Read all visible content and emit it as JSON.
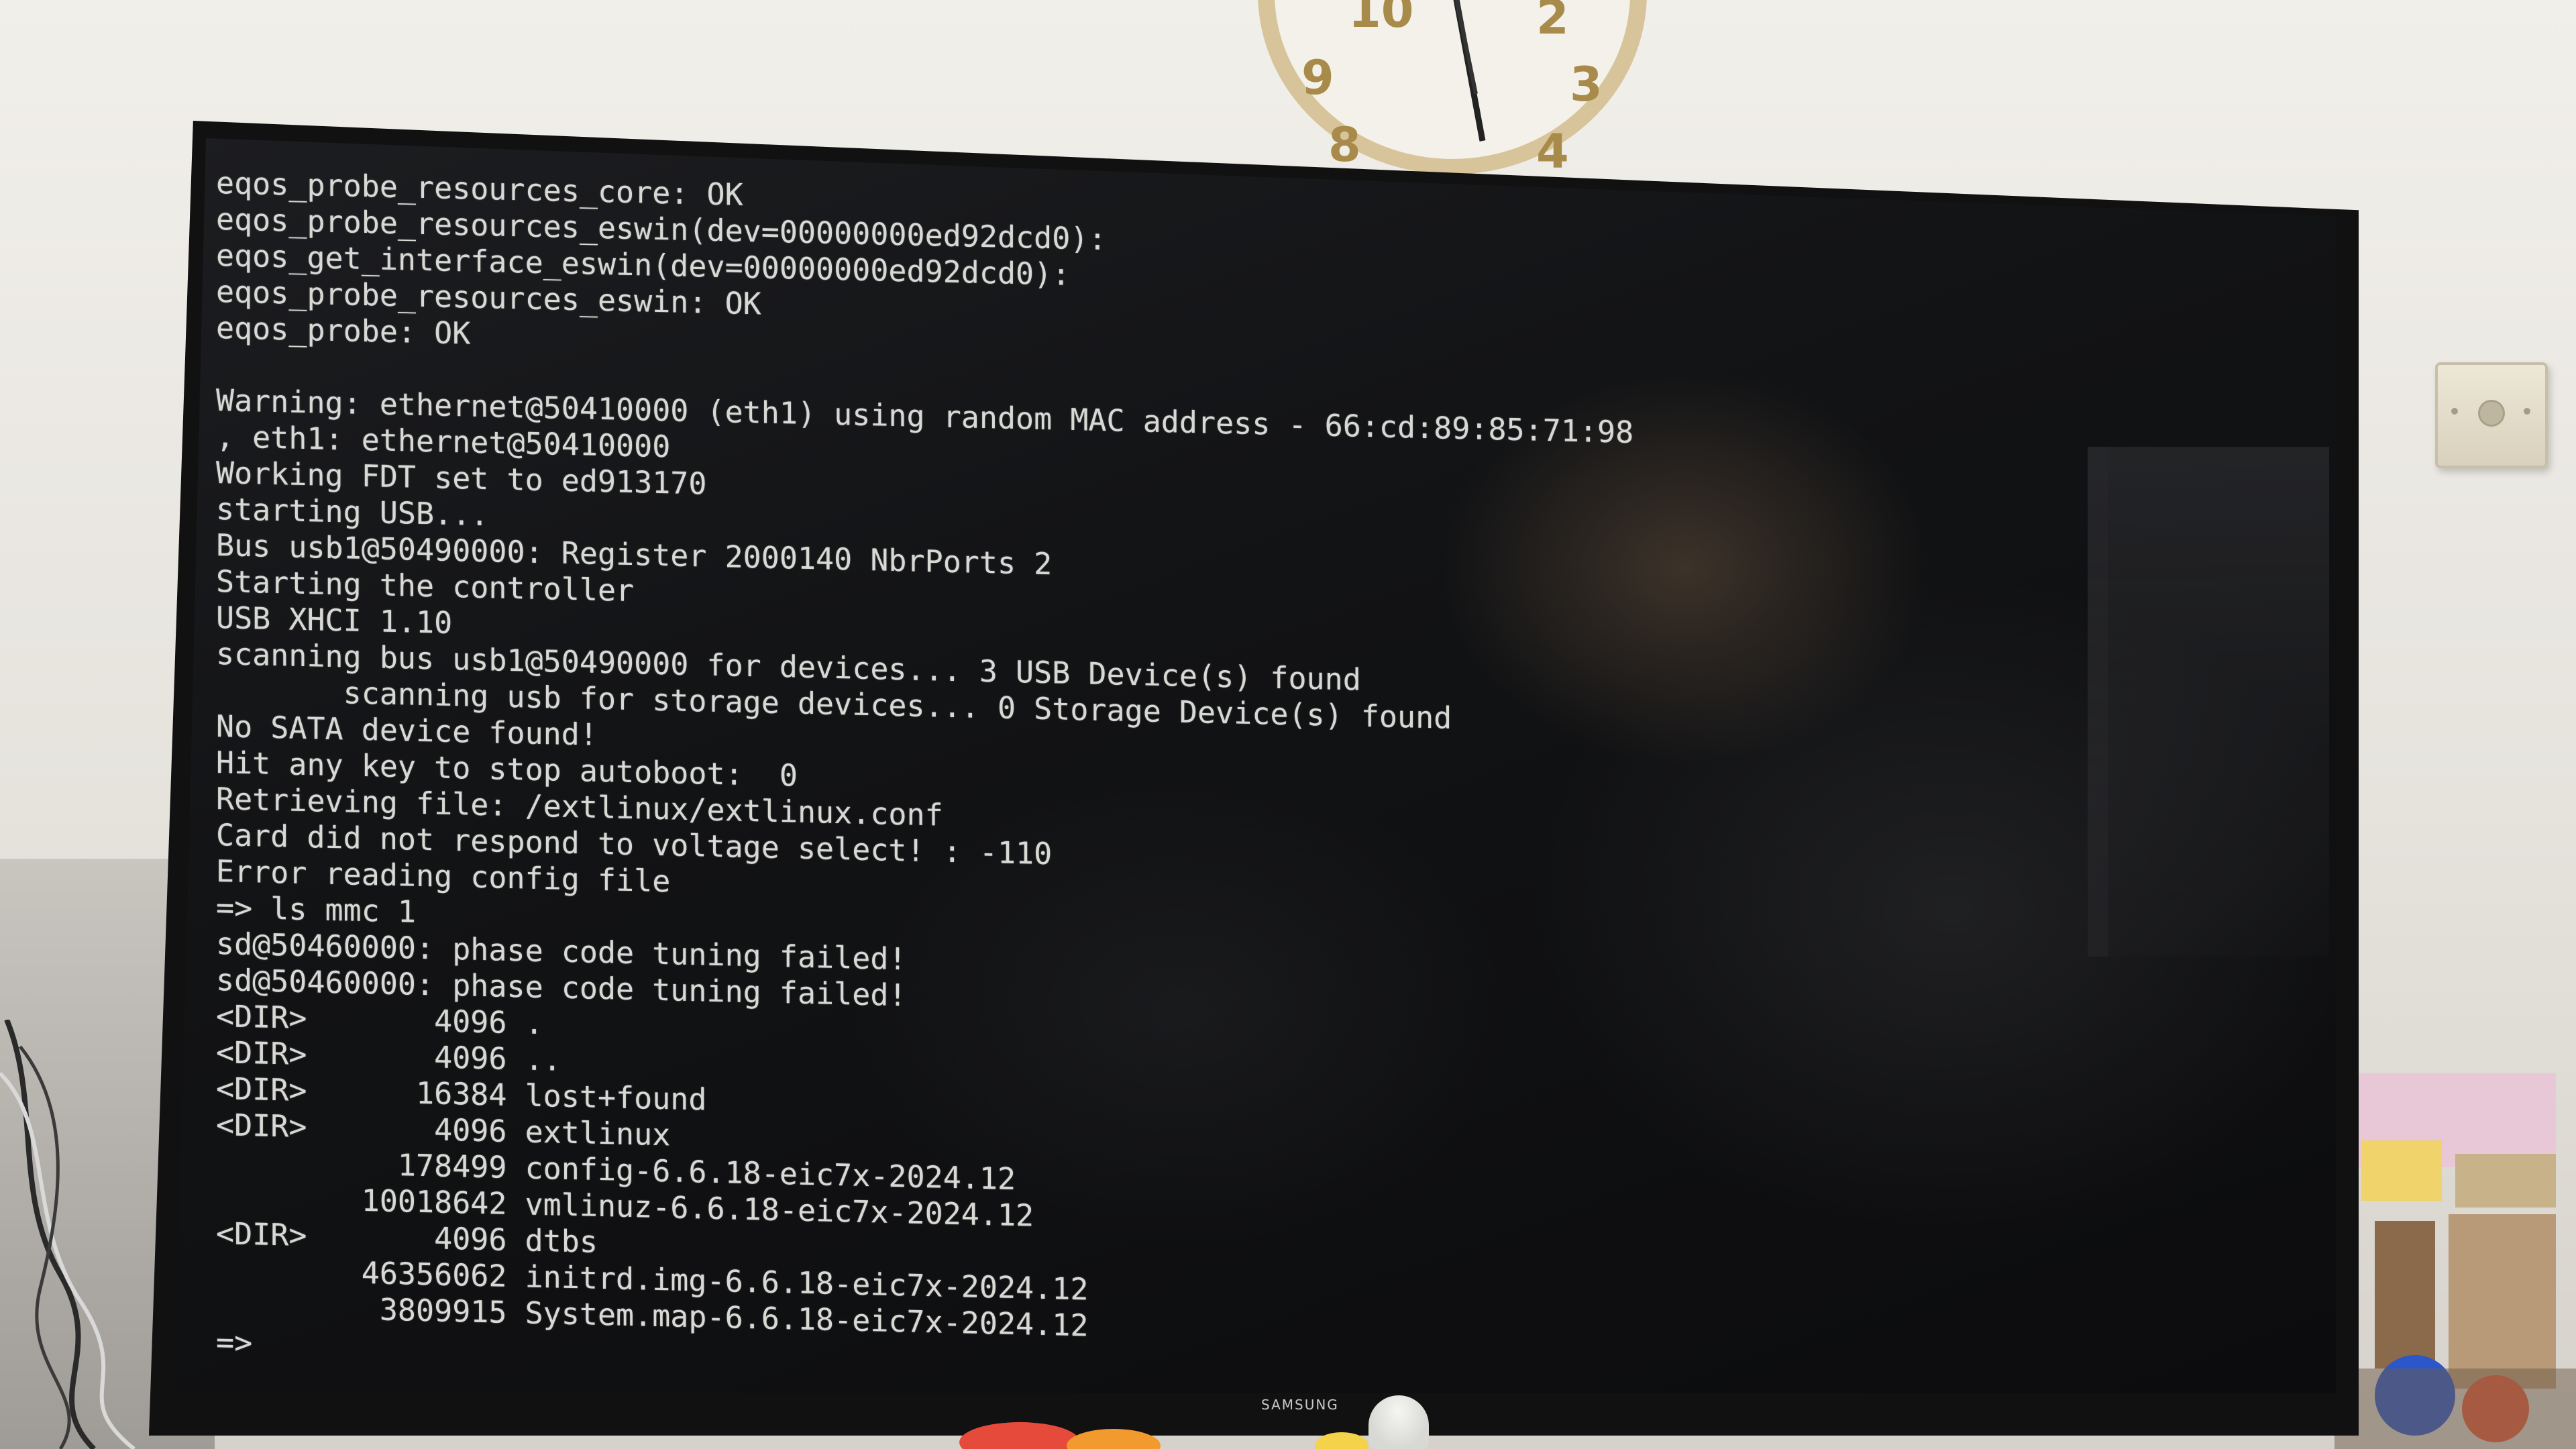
{
  "terminal": {
    "lines": [
      "eqos_probe_resources_core: OK",
      "eqos_probe_resources_eswin(dev=00000000ed92dcd0):",
      "eqos_get_interface_eswin(dev=00000000ed92dcd0):",
      "eqos_probe_resources_eswin: OK",
      "eqos_probe: OK",
      "",
      "Warning: ethernet@50410000 (eth1) using random MAC address - 66:cd:89:85:71:98",
      ", eth1: ethernet@50410000",
      "Working FDT set to ed913170",
      "starting USB...",
      "Bus usb1@50490000: Register 2000140 NbrPorts 2",
      "Starting the controller",
      "USB XHCI 1.10",
      "scanning bus usb1@50490000 for devices... 3 USB Device(s) found",
      "       scanning usb for storage devices... 0 Storage Device(s) found",
      "No SATA device found!",
      "Hit any key to stop autoboot:  0",
      "Retrieving file: /extlinux/extlinux.conf",
      "Card did not respond to voltage select! : -110",
      "Error reading config file",
      "=> ls mmc 1",
      "sd@50460000: phase code tuning failed!",
      "sd@50460000: phase code tuning failed!",
      "<DIR>       4096 .",
      "<DIR>       4096 ..",
      "<DIR>      16384 lost+found",
      "<DIR>       4096 extlinux",
      "          178499 config-6.6.18-eic7x-2024.12",
      "        10018642 vmlinuz-6.6.18-eic7x-2024.12",
      "<DIR>       4096 dtbs",
      "        46356062 initrd.img-6.6.18-eic7x-2024.12",
      "         3809915 System.map-6.6.18-eic7x-2024.12",
      "=>"
    ]
  },
  "tv": {
    "brand": "SAMSUNG"
  },
  "clock": {
    "numerals": [
      "10",
      "2",
      "9",
      "3",
      "8",
      "4"
    ]
  },
  "colors": {
    "terminal_text": "#d8d8d4",
    "screen_bg": "#121315",
    "wall": "#ebe8e2"
  }
}
